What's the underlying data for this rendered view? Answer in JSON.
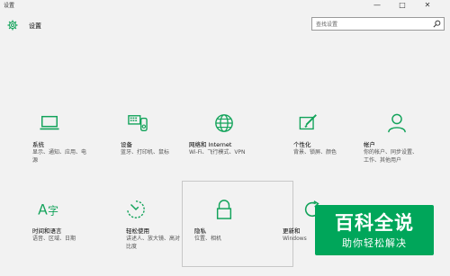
{
  "window": {
    "title": "设置",
    "min": "—",
    "max": "□",
    "close": "✕"
  },
  "header": {
    "title": "设置",
    "search_placeholder": "查找设置"
  },
  "accent": "#12a35a",
  "tiles": [
    {
      "key": "system",
      "icon": "laptop-icon",
      "name": "系统",
      "desc": [
        "显示、通知、应用、电",
        "源"
      ]
    },
    {
      "key": "devices",
      "icon": "devices-icon",
      "name": "设备",
      "desc": [
        "蓝牙、打印机、鼠标"
      ]
    },
    {
      "key": "network",
      "icon": "globe-icon",
      "name": "网络和 Internet",
      "desc": [
        "Wi-Fi、飞行模式、VPN"
      ]
    },
    {
      "key": "personalization",
      "icon": "paint-icon",
      "name": "个性化",
      "desc": [
        "背景、锁屏、颜色"
      ]
    },
    {
      "key": "accounts",
      "icon": "person-icon",
      "name": "帐户",
      "desc": [
        "你的帐户、同步设置、",
        "工作、其他用户"
      ]
    },
    {
      "key": "time-language",
      "icon": "time-language-icon",
      "name": "时间和语言",
      "desc": [
        "语音、区域、日期"
      ]
    },
    {
      "key": "ease-of-access",
      "icon": "ease-of-access-icon",
      "name": "轻松使用",
      "desc": [
        "讲述人、放大镜、高对",
        "比度"
      ]
    },
    {
      "key": "privacy",
      "icon": "lock-icon",
      "name": "隐私",
      "desc": [
        "位置、相机"
      ]
    },
    {
      "key": "update-security",
      "icon": "refresh-icon",
      "name": "更新和",
      "desc": [
        "Windows"
      ]
    }
  ],
  "watermark": {
    "line1": "百科全说",
    "line2": "助你轻松解决"
  }
}
